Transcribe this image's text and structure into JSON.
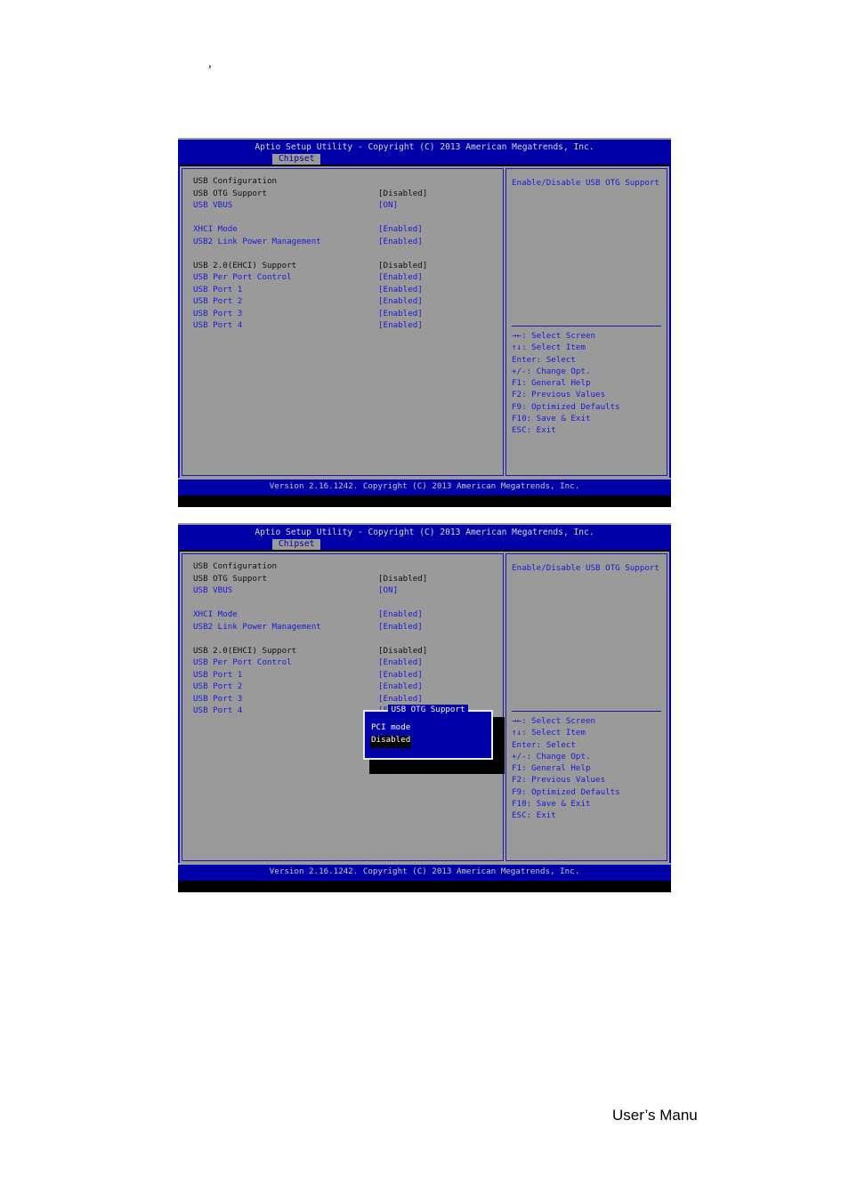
{
  "page": {
    "stray_mark": ",",
    "footer_text": "User’s Manu"
  },
  "colors": {
    "bios_blue": "#0000a8",
    "bios_gray": "#9a9a9a",
    "item_blue": "#1a1ad8",
    "text_black": "#101010",
    "highlight_black": "#000000"
  },
  "bios": {
    "title": "Aptio Setup Utility - Copyright (C) 2013 American Megatrends, Inc.",
    "tab": "Chipset",
    "footer": "Version 2.16.1242. Copyright (C) 2013 American Megatrends, Inc.",
    "section_title": "USB Configuration",
    "settings": [
      {
        "label": "USB OTG Support",
        "value": "[Disabled]",
        "style": "sel"
      },
      {
        "label": "USB VBUS",
        "value": "[ON]",
        "style": "item"
      },
      {
        "label": "",
        "value": "",
        "style": "spacer"
      },
      {
        "label": "XHCI Mode",
        "value": "[Enabled]",
        "style": "item"
      },
      {
        "label": "USB2 Link Power Management",
        "value": "[Enabled]",
        "style": "item"
      },
      {
        "label": "",
        "value": "",
        "style": "spacer"
      },
      {
        "label": "USB 2.0(EHCI) Support",
        "value": "[Disabled]",
        "style": "dim"
      },
      {
        "label": "USB Per Port Control",
        "value": "[Enabled]",
        "style": "item"
      },
      {
        "label": "USB Port 1",
        "value": "[Enabled]",
        "style": "item"
      },
      {
        "label": "USB Port 2",
        "value": "[Enabled]",
        "style": "item"
      },
      {
        "label": "USB Port 3",
        "value": "[Enabled]",
        "style": "item"
      },
      {
        "label": "USB Port 4",
        "value": "[Enabled]",
        "style": "item"
      }
    ],
    "help_text": "Enable/Disable USB OTG Support",
    "nav_keys": [
      "→←: Select Screen",
      "↑↓: Select Item",
      "Enter: Select",
      "+/-: Change Opt.",
      "F1: General Help",
      "F2: Previous Values",
      "F9: Optimized Defaults",
      "F10: Save & Exit",
      "ESC: Exit"
    ]
  },
  "popup": {
    "title": "USB OTG Support",
    "options": [
      {
        "label": "PCI mode",
        "selected": false
      },
      {
        "label": "Disabled",
        "selected": true
      }
    ]
  }
}
